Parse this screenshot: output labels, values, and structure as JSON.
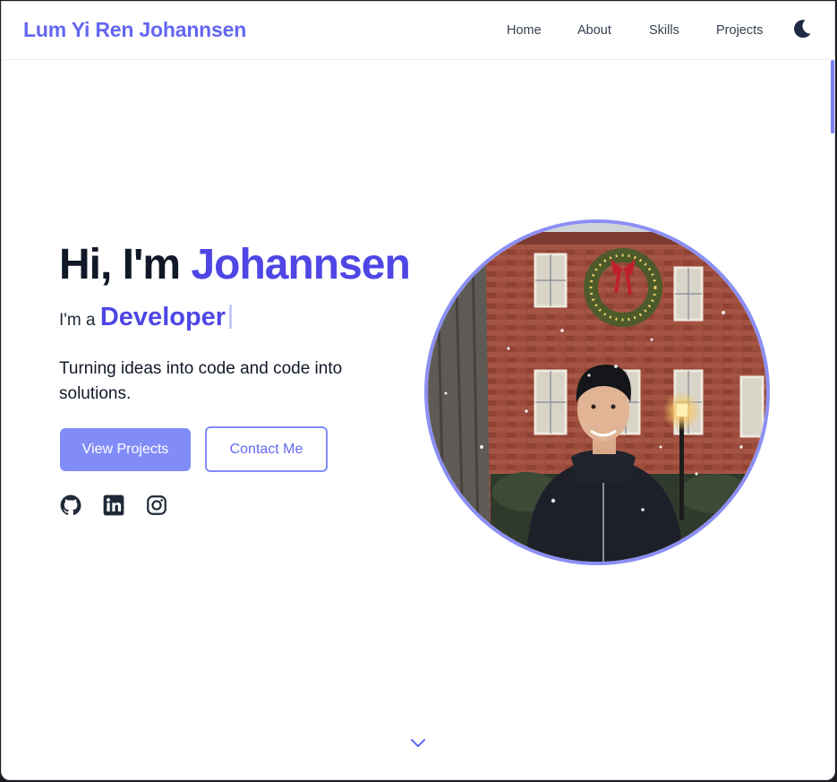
{
  "navbar": {
    "brand": "Lum Yi Ren Johannsen",
    "links": [
      "Home",
      "About",
      "Skills",
      "Projects"
    ],
    "theme_icon": "moon-icon"
  },
  "hero": {
    "greeting": "Hi, I'm ",
    "name": "Johannsen",
    "role_prefix": "I'm a ",
    "role_word": "Developer",
    "tagline": "Turning ideas into code and code into solutions.",
    "primary_button": "View Projects",
    "secondary_button": "Contact Me",
    "social_icons": [
      "github-icon",
      "linkedin-icon",
      "instagram-icon"
    ]
  },
  "photo": {
    "subject": "profile-photo"
  },
  "colors": {
    "accent": "#6366f1",
    "accent_dark": "#4f46e5",
    "button": "#818cf8",
    "text": "#111827"
  },
  "scroll_icon": "chevron-down-icon"
}
